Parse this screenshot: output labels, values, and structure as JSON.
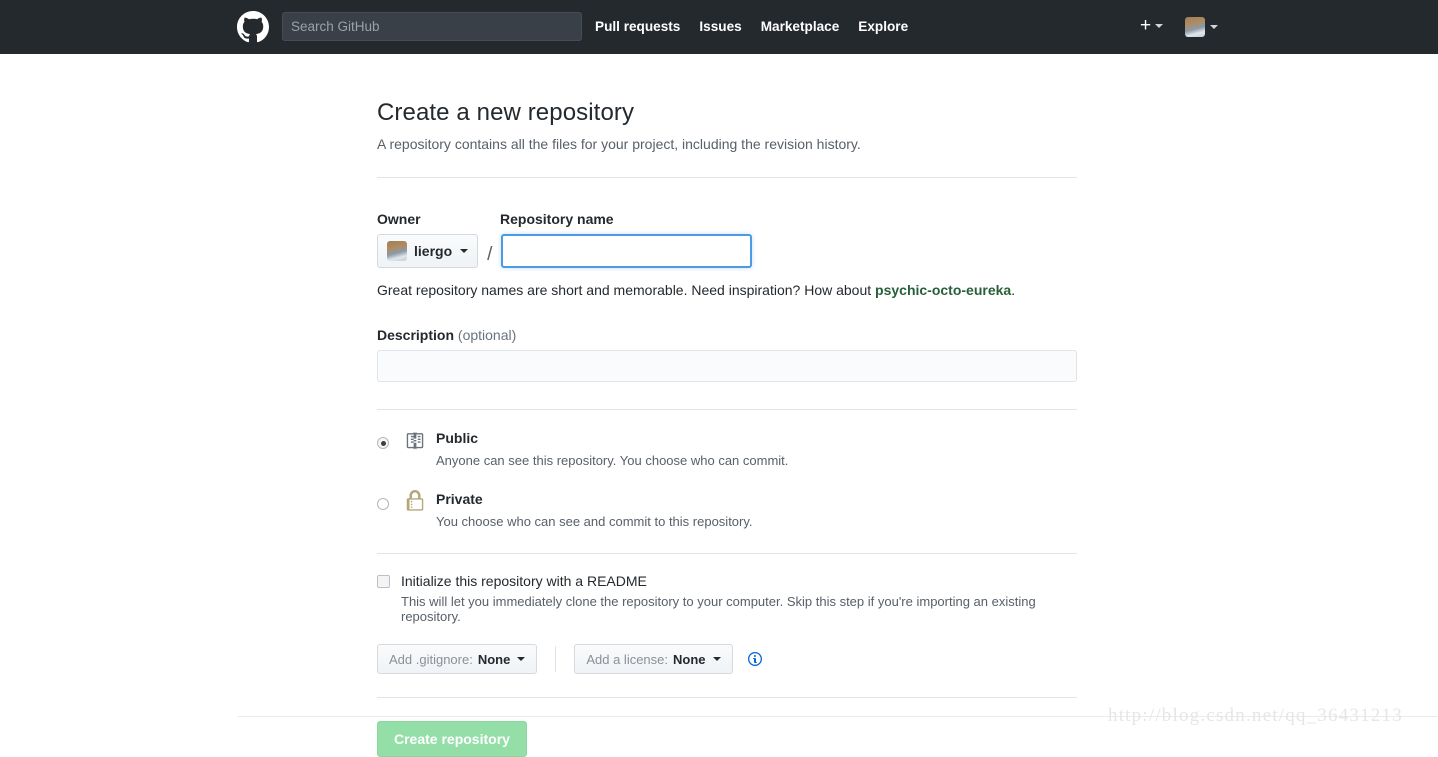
{
  "header": {
    "logo_icon": "github-octocat-icon",
    "search": {
      "placeholder": "Search GitHub",
      "value": ""
    },
    "nav": [
      {
        "label": "Pull requests"
      },
      {
        "label": "Issues"
      },
      {
        "label": "Marketplace"
      },
      {
        "label": "Explore"
      }
    ],
    "plus_glyph": "+",
    "create_new_icon": "plus-icon",
    "avatar_icon": "user-avatar",
    "background_color": "#24292e"
  },
  "page": {
    "title": "Create a new repository",
    "subtitle": "A repository contains all the files for your project, including the revision history."
  },
  "form": {
    "owner": {
      "label": "Owner",
      "name": "liergo",
      "avatar_icon": "owner-avatar"
    },
    "separator": "/",
    "repository_name": {
      "label": "Repository name",
      "value": "",
      "placeholder": ""
    },
    "hint": {
      "text_before": "Great repository names are short and memorable. Need inspiration? How about ",
      "suggestion": "psychic-octo-eureka",
      "text_after": ".",
      "suggestion_color": "#28603a"
    },
    "description": {
      "label": "Description",
      "optional": "(optional)",
      "value": "",
      "placeholder": ""
    },
    "visibility": {
      "options": [
        {
          "id": "public",
          "title": "Public",
          "description": "Anyone can see this repository. You choose who can commit.",
          "icon": "repo-book-icon",
          "selected": true
        },
        {
          "id": "private",
          "title": "Private",
          "description": "You choose who can see and commit to this repository.",
          "icon": "lock-icon",
          "selected": false
        }
      ]
    },
    "readme": {
      "label": "Initialize this repository with a README",
      "description": "This will let you immediately clone the repository to your computer. Skip this step if you're importing an existing repository.",
      "checked": false
    },
    "gitignore": {
      "prefix": "Add .gitignore:",
      "value": "None"
    },
    "license": {
      "prefix": "Add a license:",
      "value": "None"
    },
    "info_icon": "info-circle-icon",
    "submit": {
      "label": "Create repository",
      "color": "#94dfa8",
      "disabled": true
    }
  },
  "watermark": {
    "text": "http://blog.csdn.net/qq_36431213"
  }
}
